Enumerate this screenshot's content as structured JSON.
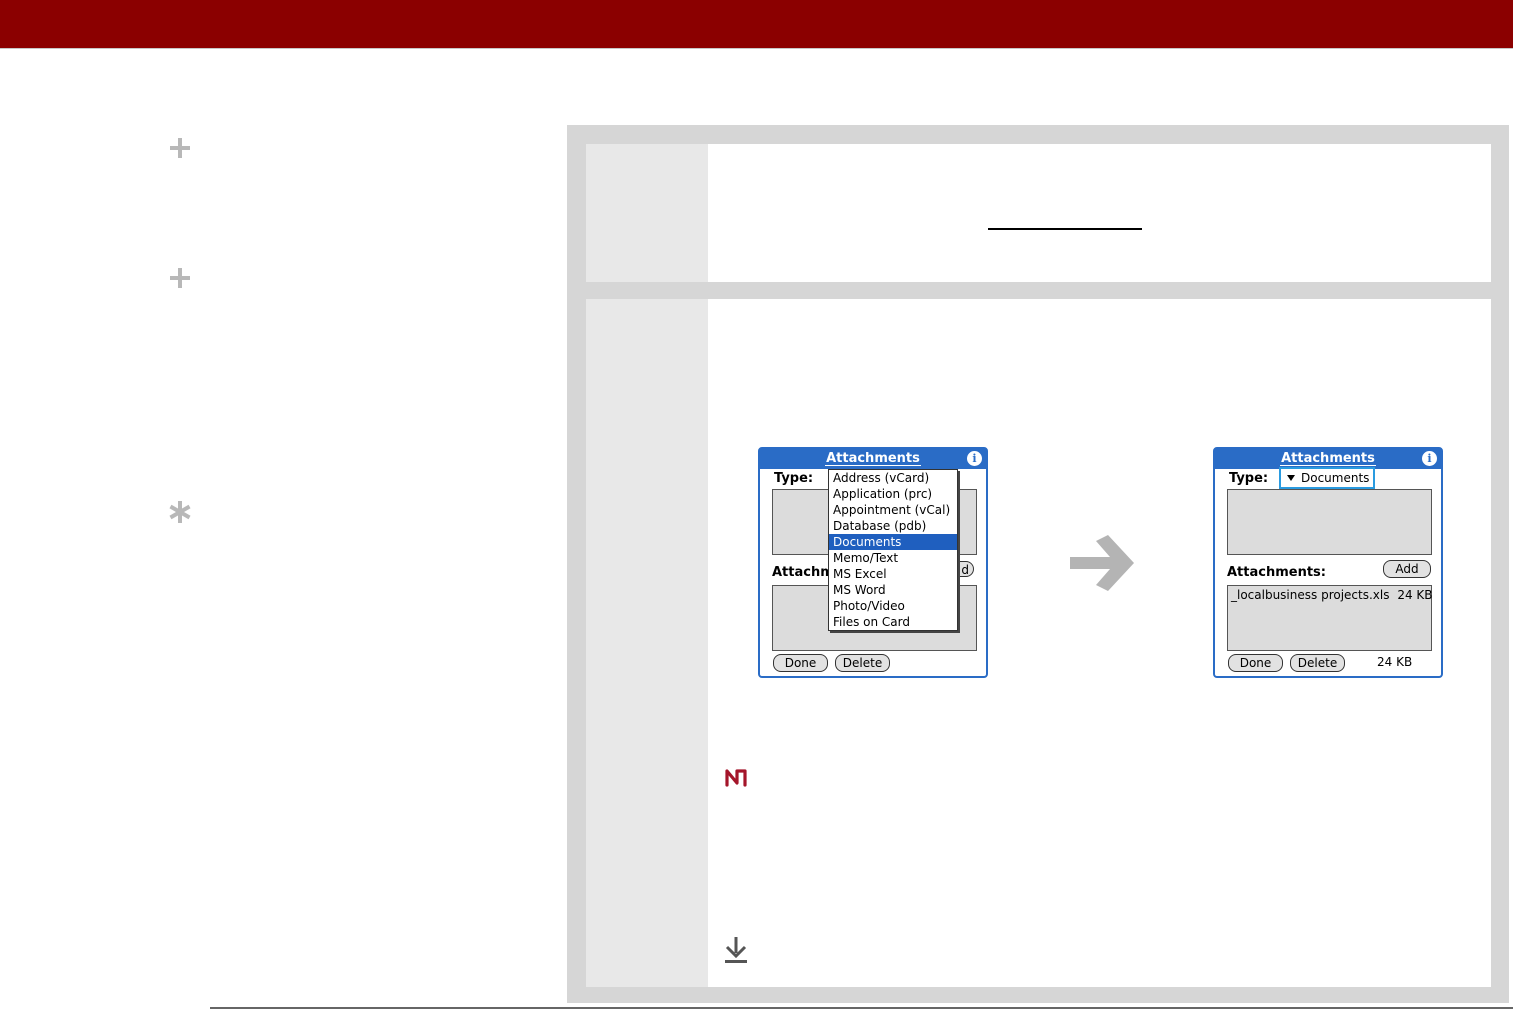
{
  "icons": {
    "side": [
      "plus-icon",
      "plus-icon",
      "asterisk-icon"
    ],
    "step2": [
      "note-icon",
      "download-arrow-icon"
    ]
  },
  "colors": {
    "header": "#8b0000",
    "panel": "#d6d6d6",
    "dialog_accent": "#2a6cc6",
    "menu_selected": "#1f5fbf"
  },
  "dialog_left": {
    "title": "Attachments",
    "info_glyph": "i",
    "type_label": "Type:",
    "attachments_label_partial": "Attachm",
    "add_partial": "d",
    "menu_items": [
      "Address (vCard)",
      "Application (prc)",
      "Appointment (vCal)",
      "Database (pdb)",
      "Documents",
      "Memo/Text",
      "MS Excel",
      "MS Word",
      "Photo/Video",
      "Files on Card"
    ],
    "selected_item": "Documents",
    "done": "Done",
    "delete": "Delete"
  },
  "dialog_right": {
    "title": "Attachments",
    "info_glyph": "i",
    "type_label": "Type:",
    "type_value": "Documents",
    "attachments_label": "Attachments:",
    "add": "Add",
    "attachment_item": "_localbusiness projects.xls",
    "attachment_size": "24 KB",
    "done": "Done",
    "delete": "Delete",
    "total_size": "24 KB"
  }
}
